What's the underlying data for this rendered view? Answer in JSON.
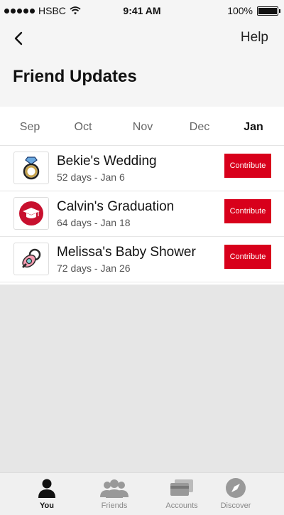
{
  "status_bar": {
    "carrier": "HSBC",
    "time": "9:41 AM",
    "battery": "100%"
  },
  "header": {
    "help": "Help",
    "title": "Friend Updates"
  },
  "months": [
    {
      "label": "Sep",
      "active": false
    },
    {
      "label": "Oct",
      "active": false
    },
    {
      "label": "Nov",
      "active": false
    },
    {
      "label": "Dec",
      "active": false
    },
    {
      "label": "Jan",
      "active": true
    }
  ],
  "events": [
    {
      "title": "Bekie's Wedding",
      "subtitle": "52 days - Jan 6",
      "action": "Contribute",
      "icon": "ring-icon"
    },
    {
      "title": "Calvin's Graduation",
      "subtitle": "64 days - Jan 18",
      "action": "Contribute",
      "icon": "graduation-cap-icon"
    },
    {
      "title": "Melissa's Baby Shower",
      "subtitle": "72 days - Jan 26",
      "action": "Contribute",
      "icon": "pacifier-icon"
    }
  ],
  "tabs": [
    {
      "label": "You",
      "icon": "person-icon",
      "active": true
    },
    {
      "label": "Friends",
      "icon": "friends-icon",
      "active": false
    },
    {
      "label": "Accounts",
      "icon": "cards-icon",
      "active": false
    },
    {
      "label": "Discover",
      "icon": "compass-icon",
      "active": false
    }
  ],
  "colors": {
    "accent": "#d8001b",
    "header_bg": "#f5f5f5",
    "page_bg": "#e6e6e6"
  }
}
